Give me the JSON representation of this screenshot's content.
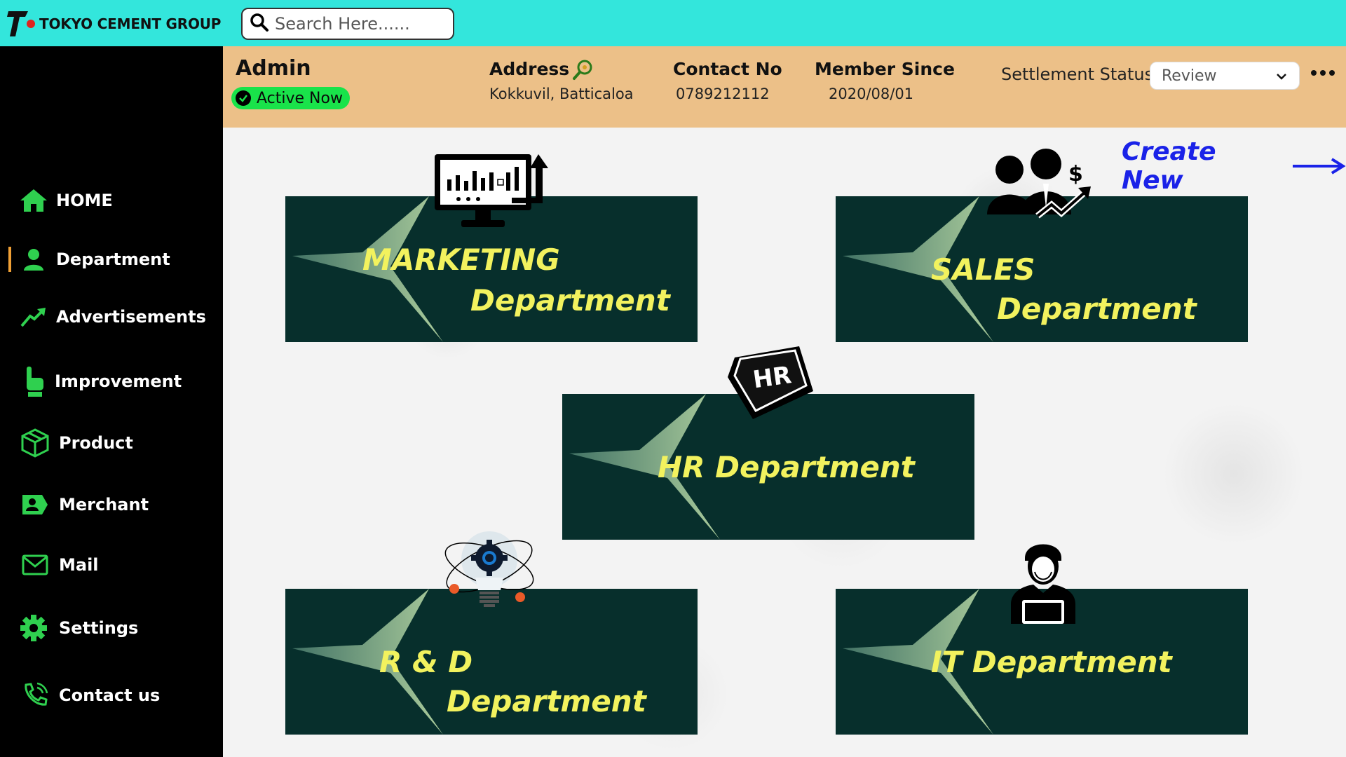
{
  "topbar": {
    "brand": "TOKYO CEMENT GROUP",
    "search_placeholder": "Search Here......",
    "bg_color": "#33e6dc"
  },
  "sidebar": {
    "items": [
      {
        "label": "HOME",
        "icon": "home-icon"
      },
      {
        "label": "Department",
        "icon": "user-icon",
        "active": true
      },
      {
        "label": "Advertisements",
        "icon": "trending-up-icon"
      },
      {
        "label": "Improvement",
        "icon": "pointing-hand-icon"
      },
      {
        "label": "Product",
        "icon": "box-icon"
      },
      {
        "label": "Merchant",
        "icon": "merchant-tag-icon"
      },
      {
        "label": "Mail",
        "icon": "mail-icon"
      },
      {
        "label": "Settings",
        "icon": "gear-icon"
      },
      {
        "label": "Contact us",
        "icon": "phone-icon"
      }
    ],
    "icon_color": "#2fd04f",
    "active_indicator_color": "#f0a035"
  },
  "profile": {
    "name": "Admin",
    "status": "Active Now",
    "address_label": "Address",
    "address_value": "Kokkuvil, Batticaloa",
    "contact_label": "Contact No",
    "contact_value": "0789212112",
    "member_label": "Member Since",
    "member_value": "2020/08/01",
    "settlement_label": "Settlement Status",
    "settlement_value": "Review",
    "bg_color": "#ecc088"
  },
  "main": {
    "create_new": "Create New",
    "departments": [
      {
        "line1": "MARKETING",
        "line2": "Department",
        "icon": "monitor-chart-icon"
      },
      {
        "line1": "SALES",
        "line2": "Department",
        "icon": "business-people-icon"
      },
      {
        "line1": "HR Department",
        "line2": "",
        "icon": "hr-key-icon"
      },
      {
        "line1": "R & D",
        "line2": "Department",
        "icon": "lightbulb-gear-icon"
      },
      {
        "line1": "IT  Department",
        "line2": "",
        "icon": "it-worker-icon"
      }
    ],
    "card_color": "#072f2c",
    "text_color": "#f2f25e",
    "link_color": "#1a22e8"
  }
}
